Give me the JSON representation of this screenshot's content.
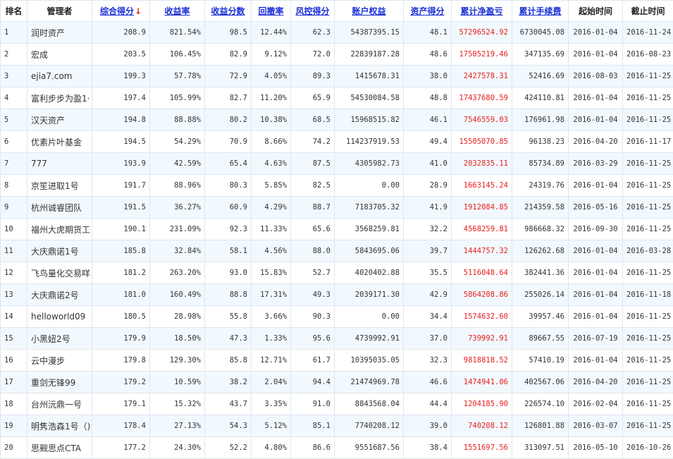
{
  "header": {
    "rank": "排名",
    "manager": "管理者",
    "composite_score": "综合得分",
    "sort_arrow": "↓",
    "return_rate": "收益率",
    "return_score": "收益分数",
    "drawdown": "回撤率",
    "risk_score": "风控得分",
    "equity": "账户权益",
    "asset_score": "资产得分",
    "cum_pnl": "累计净盈亏",
    "cum_fee": "累计手续费",
    "start_date": "起始时间",
    "end_date": "截止时间"
  },
  "colors": {
    "link": "#1a2fd6",
    "pnl": "#e8201e",
    "row_alt": "#f2f9fe",
    "border": "#dfe6ee"
  },
  "rows": [
    {
      "rank": "1",
      "manager": "润时资产",
      "score": "208.9",
      "ret": "821.54%",
      "ret_score": "98.5",
      "dd": "12.44%",
      "risk": "62.3",
      "equity": "54387395.15",
      "asset": "48.1",
      "pnl": "57296524.92",
      "fee": "6730045.08",
      "start": "2016-01-04",
      "end": "2016-11-24"
    },
    {
      "rank": "2",
      "manager": "宏成",
      "score": "203.5",
      "ret": "106.45%",
      "ret_score": "82.9",
      "dd": "9.12%",
      "risk": "72.0",
      "equity": "22839187.28",
      "asset": "48.6",
      "pnl": "17505219.46",
      "fee": "347135.69",
      "start": "2016-01-04",
      "end": "2016-08-23"
    },
    {
      "rank": "3",
      "manager": "ejia7.com",
      "score": "199.3",
      "ret": "57.78%",
      "ret_score": "72.9",
      "dd": "4.05%",
      "risk": "89.3",
      "equity": "1415678.31",
      "asset": "38.0",
      "pnl": "2427578.31",
      "fee": "52416.69",
      "start": "2016-08-03",
      "end": "2016-11-25"
    },
    {
      "rank": "4",
      "manager": "富利步步为盈1·",
      "score": "197.4",
      "ret": "105.99%",
      "ret_score": "82.7",
      "dd": "11.20%",
      "risk": "65.9",
      "equity": "54530084.58",
      "asset": "48.8",
      "pnl": "17437680.59",
      "fee": "424110.81",
      "start": "2016-01-04",
      "end": "2016-11-25"
    },
    {
      "rank": "5",
      "manager": "汉天资产",
      "score": "194.8",
      "ret": "88.88%",
      "ret_score": "80.2",
      "dd": "10.38%",
      "risk": "68.5",
      "equity": "15968515.82",
      "asset": "46.1",
      "pnl": "7546559.03",
      "fee": "176961.98",
      "start": "2016-01-04",
      "end": "2016-11-25"
    },
    {
      "rank": "6",
      "manager": "优素片叶基金",
      "score": "194.5",
      "ret": "54.29%",
      "ret_score": "70.9",
      "dd": "8.66%",
      "risk": "74.2",
      "equity": "114237919.53",
      "asset": "49.4",
      "pnl": "15505070.85",
      "fee": "96138.23",
      "start": "2016-04-20",
      "end": "2016-11-17"
    },
    {
      "rank": "7",
      "manager": "777",
      "score": "193.9",
      "ret": "42.59%",
      "ret_score": "65.4",
      "dd": "4.63%",
      "risk": "87.5",
      "equity": "4305982.73",
      "asset": "41.0",
      "pnl": "2032835.11",
      "fee": "85734.89",
      "start": "2016-03-29",
      "end": "2016-11-25"
    },
    {
      "rank": "8",
      "manager": "京笙进取1号",
      "score": "191.7",
      "ret": "88.96%",
      "ret_score": "80.3",
      "dd": "5.85%",
      "risk": "82.5",
      "equity": "0.00",
      "asset": "28.9",
      "pnl": "1663145.24",
      "fee": "24319.76",
      "start": "2016-01-04",
      "end": "2016-11-25"
    },
    {
      "rank": "9",
      "manager": "杭州诚睿团队",
      "score": "191.5",
      "ret": "36.27%",
      "ret_score": "60.9",
      "dd": "4.29%",
      "risk": "88.7",
      "equity": "7183705.32",
      "asset": "41.9",
      "pnl": "1912084.85",
      "fee": "214359.58",
      "start": "2016-05-16",
      "end": "2016-11-25"
    },
    {
      "rank": "10",
      "manager": "福州大虎期货工",
      "score": "190.1",
      "ret": "231.09%",
      "ret_score": "92.3",
      "dd": "11.33%",
      "risk": "65.6",
      "equity": "3568259.81",
      "asset": "32.2",
      "pnl": "4568259.81",
      "fee": "986668.32",
      "start": "2016-09-30",
      "end": "2016-11-25"
    },
    {
      "rank": "11",
      "manager": "大庆鼎诺1号",
      "score": "185.8",
      "ret": "32.84%",
      "ret_score": "58.1",
      "dd": "4.56%",
      "risk": "88.0",
      "equity": "5843695.06",
      "asset": "39.7",
      "pnl": "1444757.32",
      "fee": "126262.68",
      "start": "2016-01-04",
      "end": "2016-03-28"
    },
    {
      "rank": "12",
      "manager": "飞鸟量化交易咩",
      "score": "181.2",
      "ret": "263.20%",
      "ret_score": "93.0",
      "dd": "15.83%",
      "risk": "52.7",
      "equity": "4020402.88",
      "asset": "35.5",
      "pnl": "5116048.64",
      "fee": "382441.36",
      "start": "2016-01-04",
      "end": "2016-11-25"
    },
    {
      "rank": "13",
      "manager": "大庆鼎诺2号",
      "score": "181.0",
      "ret": "160.49%",
      "ret_score": "88.8",
      "dd": "17.31%",
      "risk": "49.3",
      "equity": "2039171.30",
      "asset": "42.9",
      "pnl": "5864208.86",
      "fee": "255026.14",
      "start": "2016-01-04",
      "end": "2016-11-18"
    },
    {
      "rank": "14",
      "manager": "helloworld09",
      "score": "180.5",
      "ret": "28.98%",
      "ret_score": "55.8",
      "dd": "3.66%",
      "risk": "90.3",
      "equity": "0.00",
      "asset": "34.4",
      "pnl": "1574632.60",
      "fee": "39957.46",
      "start": "2016-01-04",
      "end": "2016-11-25"
    },
    {
      "rank": "15",
      "manager": "小黑妞2号",
      "score": "179.9",
      "ret": "18.50%",
      "ret_score": "47.3",
      "dd": "1.33%",
      "risk": "95.6",
      "equity": "4739992.91",
      "asset": "37.0",
      "pnl": "739992.91",
      "fee": "89667.55",
      "start": "2016-07-19",
      "end": "2016-11-25"
    },
    {
      "rank": "16",
      "manager": "云中漫步",
      "score": "179.8",
      "ret": "129.30%",
      "ret_score": "85.8",
      "dd": "12.71%",
      "risk": "61.7",
      "equity": "10395035.05",
      "asset": "32.3",
      "pnl": "9818818.52",
      "fee": "57410.19",
      "start": "2016-01-04",
      "end": "2016-11-25"
    },
    {
      "rank": "17",
      "manager": "重剑无锋99",
      "score": "179.2",
      "ret": "10.59%",
      "ret_score": "38.2",
      "dd": "2.04%",
      "risk": "94.4",
      "equity": "21474969.78",
      "asset": "46.6",
      "pnl": "1474941.06",
      "fee": "402567.06",
      "start": "2016-04-20",
      "end": "2016-11-25"
    },
    {
      "rank": "18",
      "manager": "台州沅鼎一号",
      "score": "179.1",
      "ret": "15.32%",
      "ret_score": "43.7",
      "dd": "3.35%",
      "risk": "91.0",
      "equity": "8843568.04",
      "asset": "44.4",
      "pnl": "1204185.90",
      "fee": "226574.10",
      "start": "2016-02-04",
      "end": "2016-11-25"
    },
    {
      "rank": "19",
      "manager": "明隽浩森1号（)",
      "score": "178.4",
      "ret": "27.13%",
      "ret_score": "54.3",
      "dd": "5.12%",
      "risk": "85.1",
      "equity": "7740208.12",
      "asset": "39.0",
      "pnl": "740208.12",
      "fee": "126801.88",
      "start": "2016-03-07",
      "end": "2016-11-25"
    },
    {
      "rank": "20",
      "manager": "思觋思点CTA",
      "score": "177.2",
      "ret": "24.30%",
      "ret_score": "52.2",
      "dd": "4.80%",
      "risk": "86.6",
      "equity": "9551687.56",
      "asset": "38.4",
      "pnl": "1551697.56",
      "fee": "313097.51",
      "start": "2016-05-10",
      "end": "2016-10-26"
    }
  ]
}
